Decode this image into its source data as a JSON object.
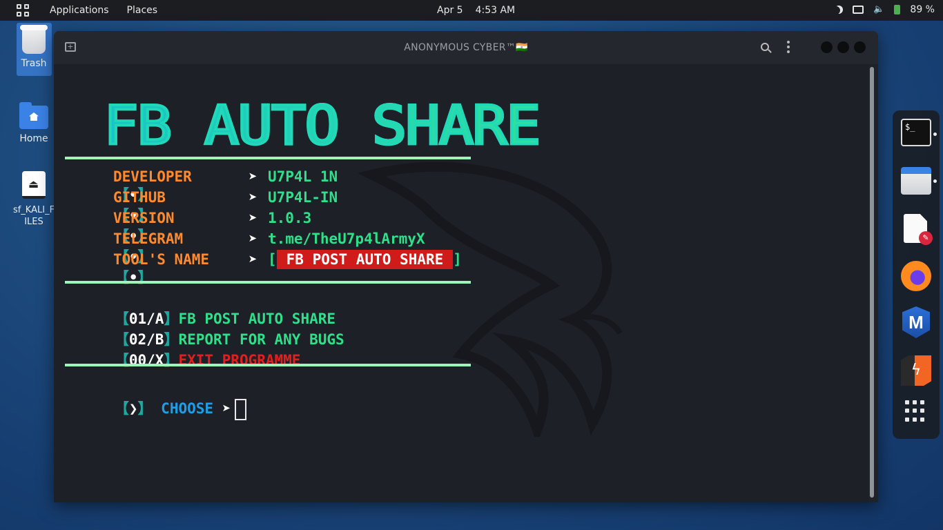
{
  "topbar": {
    "applications": "Applications",
    "places": "Places",
    "date": "Apr 5",
    "time": "4:53 AM",
    "battery": "89 %"
  },
  "desktop": {
    "icons": [
      {
        "label": "Trash",
        "icon": "trash-icon"
      },
      {
        "label": "Home",
        "icon": "home-folder-icon"
      },
      {
        "label": "sf_KALI_FILES",
        "icon": "drive-icon"
      }
    ]
  },
  "terminal": {
    "title": "ANONYMOUS CYBER™🇮🇳",
    "banner": "FB AUTO SHARE",
    "info_bracket_open": "【",
    "info_dot": "•",
    "info_bracket_close": "】",
    "arrow": "➤",
    "info": [
      {
        "label": "DEVELOPER",
        "value": "U7P4L 1N"
      },
      {
        "label": "GITHUB",
        "value": "U7P4L-IN"
      },
      {
        "label": "VERSION",
        "value": "1.0.3"
      },
      {
        "label": "TELEGRAM",
        "value": "t.me/TheU7p4lArmyX"
      },
      {
        "label": "TOOL'S NAME",
        "value": "FB POST AUTO SHARE"
      }
    ],
    "tag_open": "[",
    "tag_close": "]",
    "options": [
      {
        "num": "01/A",
        "text": "FB POST AUTO SHARE"
      },
      {
        "num": "02/B",
        "text": "REPORT FOR ANY BUGS"
      },
      {
        "num": "00/X",
        "text": "EXIT PROGRAMME"
      }
    ],
    "prompt_mark": "❯",
    "prompt_label": "CHOOSE"
  },
  "dock": {
    "items": [
      "terminal-icon",
      "files-icon",
      "text-editor-icon",
      "firefox-icon",
      "metasploit-icon",
      "burpsuite-icon",
      "app-grid-icon"
    ],
    "terminal_glyph": "$_"
  },
  "colors": {
    "label_orange": "#ff8a2e",
    "value_green": "#2ee08a",
    "exit_red": "#e02020",
    "choose_blue": "#1e9ee8",
    "tag_red": "#d01b1b"
  }
}
